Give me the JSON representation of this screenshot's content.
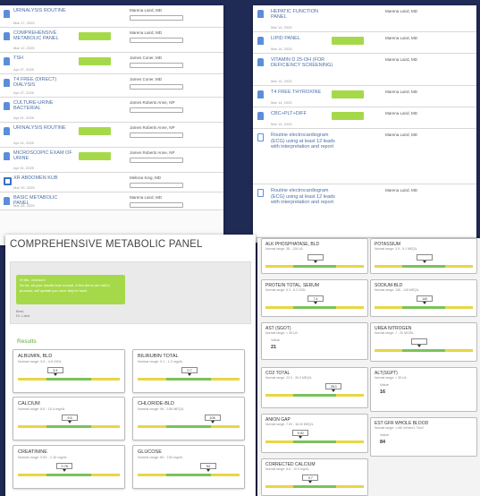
{
  "list_a": [
    {
      "name": "URINALYSIS ROUTINE",
      "date": "Mar 17, 2025",
      "doctor": "Marena Laird, MD",
      "icon": "flask-icon"
    },
    {
      "name": "COMPREHENSIVE METABOLIC PANEL",
      "date": "Mar 12, 2025",
      "tag": "",
      "doctor": "Marena Laird, MD",
      "icon": "flask-icon"
    },
    {
      "name": "TSH",
      "date": "Apr 07, 2025",
      "tag": "",
      "doctor": "James Coner, MD",
      "icon": "flask-icon"
    },
    {
      "name": "T4 FREE (DIRECT) DIALYSIS",
      "date": "Apr 07, 2025",
      "doctor": "James Coner, MD",
      "icon": "flask-icon"
    },
    {
      "name": "CULTURE-URINE BACTERIAL",
      "date": "Apr 01, 2025",
      "doctor": "James Roberts Anne, NP",
      "icon": "flask-icon"
    },
    {
      "name": "URINALYSIS ROUTINE",
      "date": "Apr 01, 2025",
      "tag": "",
      "doctor": "James Roberts Anne, NP",
      "icon": "flask-icon"
    },
    {
      "name": "MICROSCOPIC EXAM OF URINE",
      "date": "Apr 01, 2025",
      "tag": "",
      "doctor": "James Roberts Anne, NP",
      "icon": "flask-icon"
    },
    {
      "name": "XR Abdomen Kub",
      "date": "Mar 29, 2025",
      "doctor": "Melissa King, MD",
      "icon": "xray-icon"
    },
    {
      "name": "BASIC METABOLIC PANEL",
      "date": "Mar 28, 2025",
      "doctor": "Marena Laird, MD",
      "icon": "flask-icon"
    }
  ],
  "list_b": [
    {
      "name": "HEPATIC FUNCTION PANEL",
      "date": "Mar 14, 2025",
      "doctor": "Marena Laird, MD",
      "icon": "flask-icon"
    },
    {
      "name": "LIPID PANEL",
      "date": "Mar 14, 2025",
      "tag": "",
      "doctor": "Marena Laird, MD",
      "icon": "flask-icon"
    },
    {
      "name": "VITAMIN D 25-OH (FOR DEFICIENCY SCREENING)",
      "date": "Mar 14, 2025",
      "doctor": "Marena Laird, MD",
      "icon": "flask-icon"
    },
    {
      "name": "T4 FREE THYROXINE",
      "date": "Mar 14, 2025",
      "tag": "",
      "doctor": "Marena Laird, MD",
      "icon": "flask-icon"
    },
    {
      "name": "CBC+PLT+DIFF",
      "date": "Mar 14, 2025",
      "tag": "",
      "doctor": "Marena Laird, MD",
      "icon": "flask-icon"
    },
    {
      "name": "Routine electrocardiogram (ECG) using at least 12 leads with interpretation and report",
      "date": "Mar 14, 2025",
      "doctor": "Marena Laird, MD",
      "icon": "document-icon"
    },
    {
      "name": "Routine electrocardiogram (ECG) using at least 12 leads with interpretation and report",
      "date": "Mar 13, 2025",
      "doctor": "Marena Laird, MD",
      "icon": "document-icon"
    }
  ],
  "panel": {
    "title": "COMPREHENSIVE METABOLIC PANEL",
    "message": {
      "greeting": "Hi Ms. Johnson!",
      "body": "So far, all your results look normal. A few items are still in process; will update you once they're back.",
      "sent": "Best,",
      "signature": "Dr. Laird"
    },
    "results_heading": "Results",
    "results": [
      {
        "name": "ALBUMIN, BLD",
        "range": "Normal range: 3.5 - 4.8 G/DL",
        "value": "3.9",
        "pos": 0.36
      },
      {
        "name": "BILIRUBIN TOTAL",
        "range": "Normal range: 0.1 - 1.2 mg/dL",
        "value": "0.7",
        "pos": 0.5
      },
      {
        "name": "CALCIUM",
        "range": "Normal range: 8.6 - 10.4 mg/dL",
        "value": "9.6",
        "pos": 0.5
      },
      {
        "name": "CHLORIDE-BLD",
        "range": "Normal range: 96 - 106 MEQ/L",
        "value": "106",
        "pos": 0.72
      },
      {
        "name": "CREATININE",
        "range": "Normal range: 0.50 - 1.10 mg/dL",
        "value": "0.78",
        "pos": 0.45
      },
      {
        "name": "GLUCOSE",
        "range": "Normal range: 60 - 100 mg/dL",
        "value": "94",
        "pos": 0.68
      }
    ]
  },
  "panel_right": [
    {
      "name": "ALK PHOSPHATASE, BLD",
      "range": "Normal range: 38 - 126 U/L",
      "value": "",
      "pos": 0.5
    },
    {
      "name": "Potassium",
      "range": "Normal range: 3.5 - 5.1 MEQ/L",
      "value": "",
      "pos": 0.5
    },
    {
      "name": "Protein Total, Serum",
      "range": "Normal range: 6.3 - 8.2 G/DL",
      "value": "7.4",
      "pos": 0.5
    },
    {
      "name": "SODIUM-BLD",
      "range": "Normal range: 136 - 145 MEQ/L",
      "value": "140",
      "pos": 0.5
    },
    {
      "name": "AST (SGOT)",
      "range": "Normal range: < 35 U/L",
      "value": "21",
      "type": "text"
    },
    {
      "name": "UREA NITROGEN",
      "range": "Normal range: 7 - 20 MG/DL",
      "value": "",
      "pos": 0.45
    },
    {
      "name": "CO2 TOTAL",
      "range": "Normal range: 22.0 - 30.0 MEQ/L",
      "value": "28.0",
      "pos": 0.68
    },
    {
      "name": "ALT(SGPT)",
      "range": "Normal range: < 35 U/L",
      "value": "16",
      "type": "text"
    },
    {
      "name": "ANION GAP",
      "range": "Normal range: 7.00 - 16.00 MEQ/L",
      "value": "9.00",
      "pos": 0.35
    },
    {
      "name": "EST GFR Whole Blood",
      "range": "Normal range: >=60 ml/min/1.73m2",
      "value": "84",
      "type": "text"
    },
    {
      "name": "Corrected Calcium",
      "range": "Normal range: 8.6 - 10.5 mg/dL",
      "value": "9.7",
      "pos": 0.45
    }
  ]
}
